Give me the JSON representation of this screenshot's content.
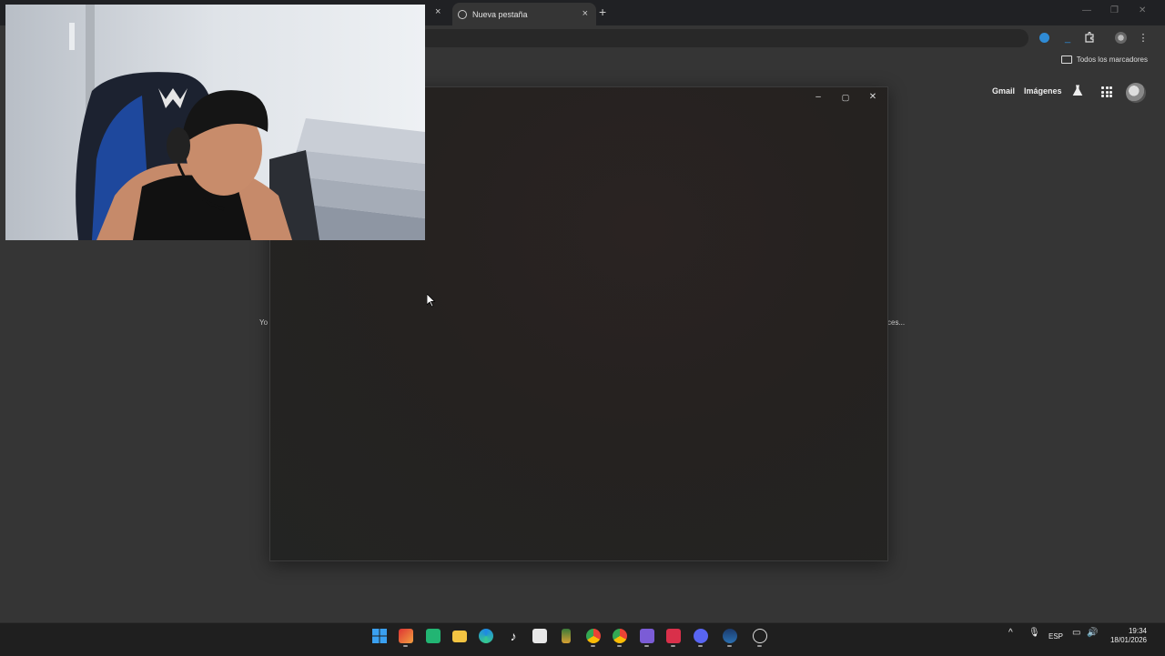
{
  "browser": {
    "active_tab_title": "Nueva pestaña",
    "tab_close_glyph": "×",
    "new_tab_glyph": "+",
    "bookmarks_bar": {
      "all_bookmarks_label": "Todos los marcadores"
    }
  },
  "google": {
    "gmail_label": "Gmail",
    "images_label": "Imágenes"
  },
  "page_hints": {
    "left_fragment": "Yo",
    "right_fragment": "ces..."
  },
  "dialog": {
    "minimize_glyph": "–",
    "maximize_glyph": "▢",
    "close_glyph": "✕"
  },
  "taskbar": {
    "language": "ESP",
    "time": "19:34",
    "date": "18/01/2026",
    "apps": [
      "windows-start-icon",
      "game-app-icon",
      "green-app-icon",
      "file-explorer-icon",
      "edge-icon",
      "tiktok-icon",
      "store-icon",
      "office-app-icon",
      "chrome-icon",
      "chrome-profile-icon",
      "purple-app-icon",
      "red-app-icon",
      "discord-icon",
      "steam-icon",
      "obs-icon"
    ]
  },
  "colors": {
    "page_bg": "#353535",
    "tabstrip_bg": "#202124",
    "taskbar_bg": "#1f1f1f",
    "dialog_bg": "#252220"
  }
}
